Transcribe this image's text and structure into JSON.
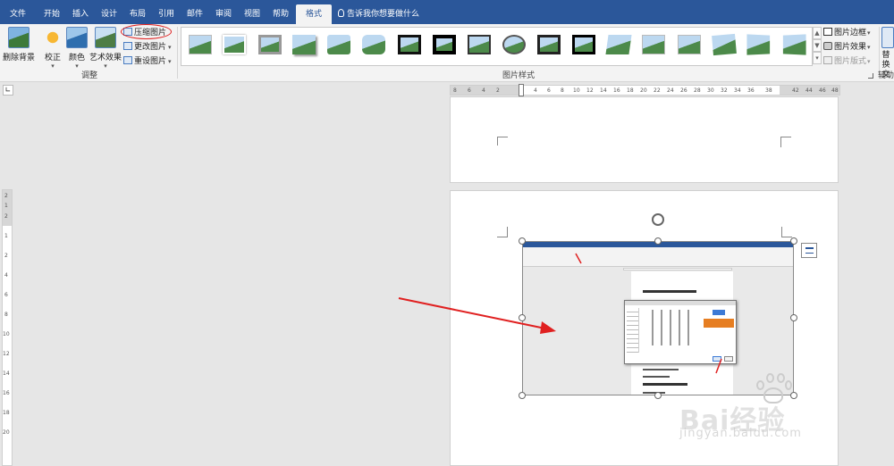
{
  "tabs": [
    "文件",
    "开始",
    "插入",
    "设计",
    "布局",
    "引用",
    "邮件",
    "审阅",
    "视图",
    "帮助",
    "格式"
  ],
  "active_tab": "格式",
  "tell_me": "告诉我你想要做什么",
  "ribbon": {
    "remove_bg": "删除背景",
    "corrections": "校正",
    "color": "颜色",
    "artistic": "艺术效果",
    "compress": "压缩图片",
    "change": "更改图片",
    "reset": "重设图片",
    "group_adjust": "调整",
    "group_styles": "图片样式",
    "border": "图片边框",
    "effects": "图片效果",
    "layout": "图片版式",
    "alt": "替换文",
    "group_aux": "辅助",
    "dropdown_mark": "▾"
  },
  "ruler_h": [
    "8",
    "6",
    "4",
    "2",
    "2",
    "4",
    "6",
    "8",
    "10",
    "12",
    "14",
    "16",
    "18",
    "20",
    "22",
    "24",
    "26",
    "28",
    "30",
    "32",
    "34",
    "36",
    "38",
    "42",
    "44",
    "46",
    "48"
  ],
  "ruler_v": [
    "2",
    "1",
    "2",
    "1",
    "2",
    "4",
    "6",
    "8",
    "10",
    "12",
    "14",
    "16",
    "18",
    "20"
  ],
  "watermark": {
    "logo_text": "Bai经验",
    "url": "jingyan.baidu.com"
  },
  "accent": "#2b579a",
  "arrow_color": "#e02020"
}
